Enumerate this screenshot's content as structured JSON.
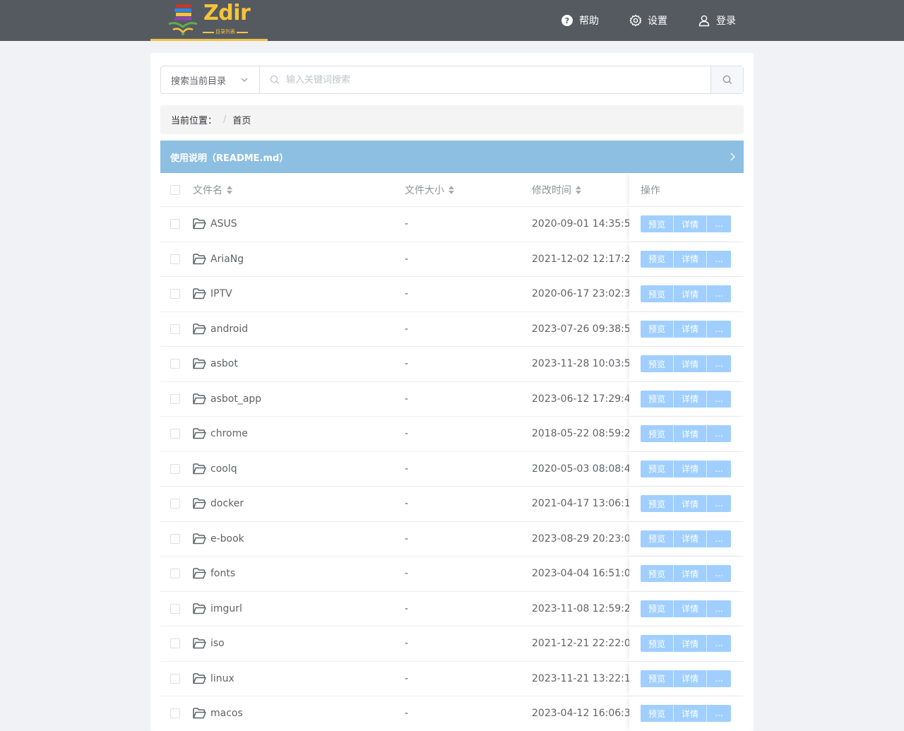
{
  "header": {
    "logo_text": "Zdir",
    "logo_subtitle": "目录列表",
    "nav": {
      "help": "帮助",
      "settings": "设置",
      "login": "登录"
    }
  },
  "search": {
    "scope": "搜索当前目录",
    "placeholder": "输入关键词搜索",
    "value": ""
  },
  "breadcrumb": {
    "label": "当前位置：",
    "separator": "/",
    "home": "首页"
  },
  "readme": {
    "title": "使用说明（README.md）"
  },
  "table": {
    "columns": {
      "name": "文件名",
      "size": "文件大小",
      "time": "修改时间",
      "ops": "操作"
    },
    "actions": {
      "preview": "预览",
      "detail": "详情",
      "more": "..."
    },
    "rows": [
      {
        "name": "ASUS",
        "size": "-",
        "time": "2020-09-01 14:35:5"
      },
      {
        "name": "AriaNg",
        "size": "-",
        "time": "2021-12-02 12:17:2"
      },
      {
        "name": "IPTV",
        "size": "-",
        "time": "2020-06-17 23:02:3"
      },
      {
        "name": "android",
        "size": "-",
        "time": "2023-07-26 09:38:5"
      },
      {
        "name": "asbot",
        "size": "-",
        "time": "2023-11-28 10:03:5"
      },
      {
        "name": "asbot_app",
        "size": "-",
        "time": "2023-06-12 17:29:4"
      },
      {
        "name": "chrome",
        "size": "-",
        "time": "2018-05-22 08:59:2"
      },
      {
        "name": "coolq",
        "size": "-",
        "time": "2020-05-03 08:08:4"
      },
      {
        "name": "docker",
        "size": "-",
        "time": "2021-04-17 13:06:1"
      },
      {
        "name": "e-book",
        "size": "-",
        "time": "2023-08-29 20:23:0"
      },
      {
        "name": "fonts",
        "size": "-",
        "time": "2023-04-04 16:51:0"
      },
      {
        "name": "imgurl",
        "size": "-",
        "time": "2023-11-08 12:59:2"
      },
      {
        "name": "iso",
        "size": "-",
        "time": "2021-12-21 22:22:0"
      },
      {
        "name": "linux",
        "size": "-",
        "time": "2023-11-21 13:22:1"
      },
      {
        "name": "macos",
        "size": "-",
        "time": "2023-04-12 16:06:3"
      }
    ]
  },
  "icons": {
    "help": "question-circle-icon",
    "settings": "gear-icon",
    "login": "user-icon",
    "search": "search-icon",
    "folder": "folder-open-icon",
    "readme_arrow": "chevron-right-icon"
  },
  "colors": {
    "header_bg": "#555a61",
    "brand_yellow": "#f5c43b",
    "readme_bg": "#8dbfe2",
    "action_btn": "#a0cfff"
  }
}
